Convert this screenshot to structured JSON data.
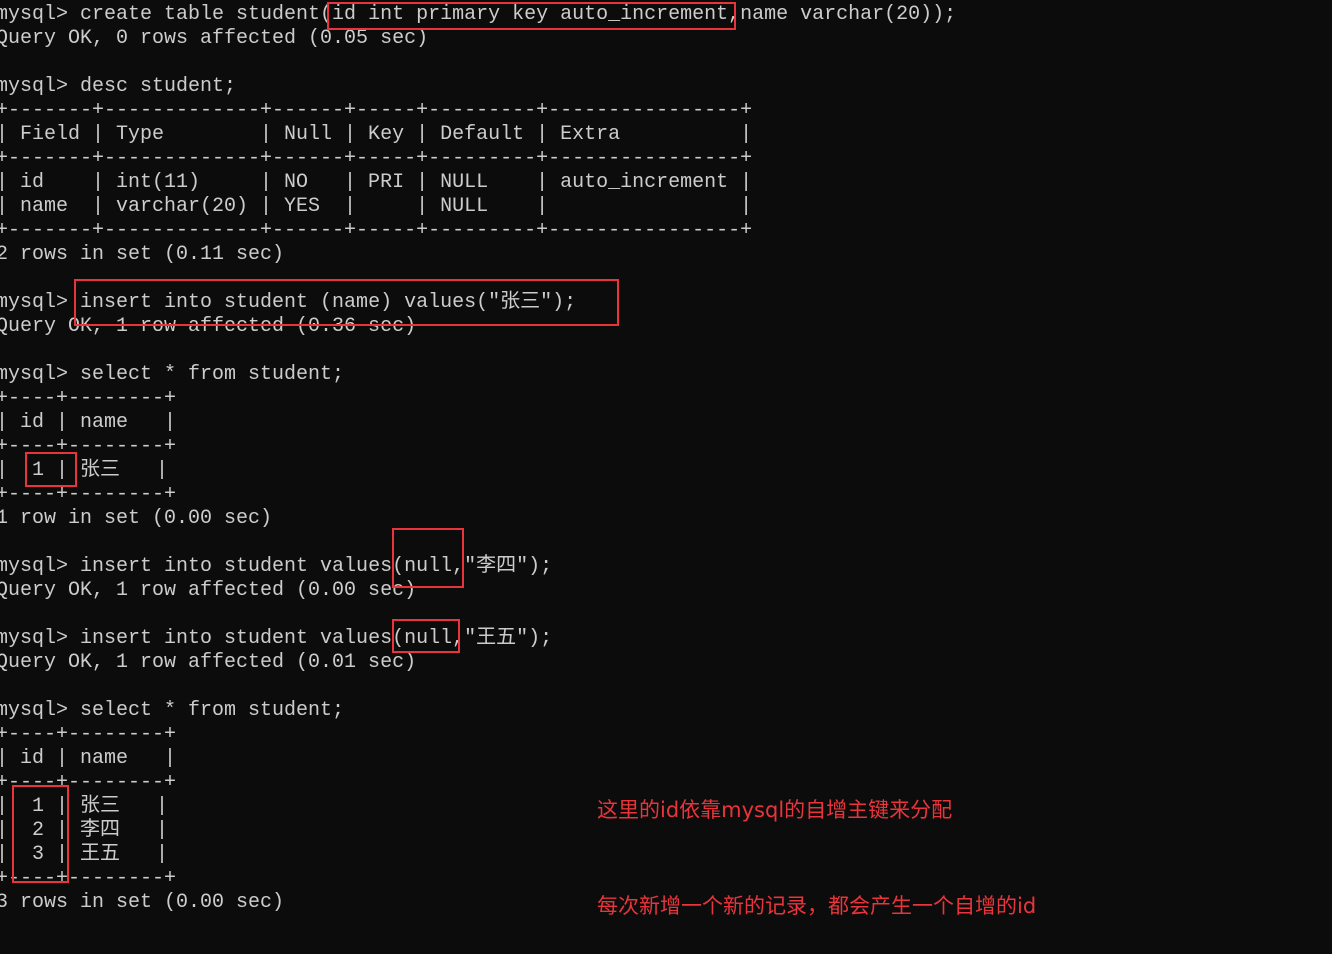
{
  "terminal": {
    "prompt": "mysql> ",
    "lines": [
      {
        "kind": "command",
        "text": "create table student(id int primary key auto_increment,name varchar(20));"
      },
      {
        "kind": "output",
        "text": "Query OK, 0 rows affected (0.05 sec)"
      },
      {
        "kind": "blank",
        "text": ""
      },
      {
        "kind": "command",
        "text": "desc student;"
      },
      {
        "kind": "table",
        "text": "+-------+-------------+------+-----+---------+----------------+"
      },
      {
        "kind": "table",
        "text": "| Field | Type        | Null | Key | Default | Extra          |"
      },
      {
        "kind": "table",
        "text": "+-------+-------------+------+-----+---------+----------------+"
      },
      {
        "kind": "table",
        "text": "| id    | int(11)     | NO   | PRI | NULL    | auto_increment |"
      },
      {
        "kind": "table",
        "text": "| name  | varchar(20) | YES  |     | NULL    |                |"
      },
      {
        "kind": "table",
        "text": "+-------+-------------+------+-----+---------+----------------+"
      },
      {
        "kind": "output",
        "text": "2 rows in set (0.11 sec)"
      },
      {
        "kind": "blank",
        "text": ""
      },
      {
        "kind": "command",
        "text": "insert into student (name) values(\"张三\");"
      },
      {
        "kind": "output",
        "text": "Query OK, 1 row affected (0.36 sec)"
      },
      {
        "kind": "blank",
        "text": ""
      },
      {
        "kind": "command",
        "text": "select * from student;"
      },
      {
        "kind": "table",
        "text": "+----+--------+"
      },
      {
        "kind": "table",
        "text": "| id | name   |"
      },
      {
        "kind": "table",
        "text": "+----+--------+"
      },
      {
        "kind": "table",
        "text": "|  1 | 张三   |"
      },
      {
        "kind": "table",
        "text": "+----+--------+"
      },
      {
        "kind": "output",
        "text": "1 row in set (0.00 sec)"
      },
      {
        "kind": "blank",
        "text": ""
      },
      {
        "kind": "command",
        "text": "insert into student values(null,\"李四\");"
      },
      {
        "kind": "output",
        "text": "Query OK, 1 row affected (0.00 sec)"
      },
      {
        "kind": "blank",
        "text": ""
      },
      {
        "kind": "command",
        "text": "insert into student values(null,\"王五\");"
      },
      {
        "kind": "output",
        "text": "Query OK, 1 row affected (0.01 sec)"
      },
      {
        "kind": "blank",
        "text": ""
      },
      {
        "kind": "command",
        "text": "select * from student;"
      },
      {
        "kind": "table",
        "text": "+----+--------+"
      },
      {
        "kind": "table",
        "text": "| id | name   |"
      },
      {
        "kind": "table",
        "text": "+----+--------+"
      },
      {
        "kind": "table",
        "text": "|  1 | 张三   |"
      },
      {
        "kind": "table",
        "text": "|  2 | 李四   |"
      },
      {
        "kind": "table",
        "text": "|  3 | 王五   |"
      },
      {
        "kind": "table",
        "text": "+----+--------+"
      },
      {
        "kind": "output",
        "text": "3 rows in set (0.00 sec)"
      }
    ]
  },
  "annotation": {
    "color": "#e8353b",
    "line1": "这里的id依靠mysql的自增主键来分配",
    "line2": "每次新增一个新的记录，都会产生一个自增的id"
  },
  "colors": {
    "background": "#0c0c0c",
    "text": "#cccccc",
    "highlight": "#e8353b"
  }
}
